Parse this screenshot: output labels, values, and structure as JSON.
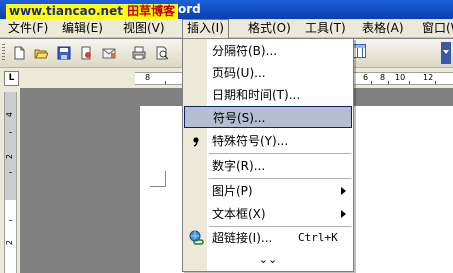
{
  "title": {
    "text": "ord"
  },
  "watermark": {
    "site": "www.tiancao.net",
    "blog": "田草博客"
  },
  "menubar": {
    "items": [
      {
        "label": "文件(F)"
      },
      {
        "label": "编辑(E)"
      },
      {
        "label": "视图(V)"
      },
      {
        "label": "插入(I)"
      },
      {
        "label": "格式(O)"
      },
      {
        "label": "工具(T)"
      },
      {
        "label": "表格(A)"
      },
      {
        "label": "窗口(W)"
      }
    ]
  },
  "ruler": {
    "tab_selector": "L",
    "h_numbers": [
      "8",
      "6",
      "8",
      "10",
      "12"
    ],
    "v_numbers": [
      "4",
      "2",
      "2"
    ]
  },
  "insert_menu": {
    "items": [
      {
        "label": "分隔符(B)...",
        "icon": ""
      },
      {
        "label": "页码(U)...",
        "icon": ""
      },
      {
        "label": "日期和时间(T)...",
        "icon": ""
      },
      {
        "label": "符号(S)...",
        "icon": "",
        "highlighted": true
      },
      {
        "label": "特殊符号(Y)...",
        "icon": "bullet-icon"
      },
      {
        "label": "数字(R)...",
        "icon": ""
      },
      {
        "label": "图片(P)",
        "icon": "",
        "submenu": true
      },
      {
        "label": "文本框(X)",
        "icon": "",
        "submenu": true
      },
      {
        "label": "超链接(I)...",
        "icon": "hyperlink-icon",
        "shortcut": "Ctrl+K"
      }
    ],
    "expand_glyph": "⌄⌄"
  },
  "colors": {
    "highlight": "#b6bdd2",
    "highlight_border": "#0a246a",
    "menubar_bg": "#ece9d8",
    "watermark_bg": "#ffff00"
  }
}
